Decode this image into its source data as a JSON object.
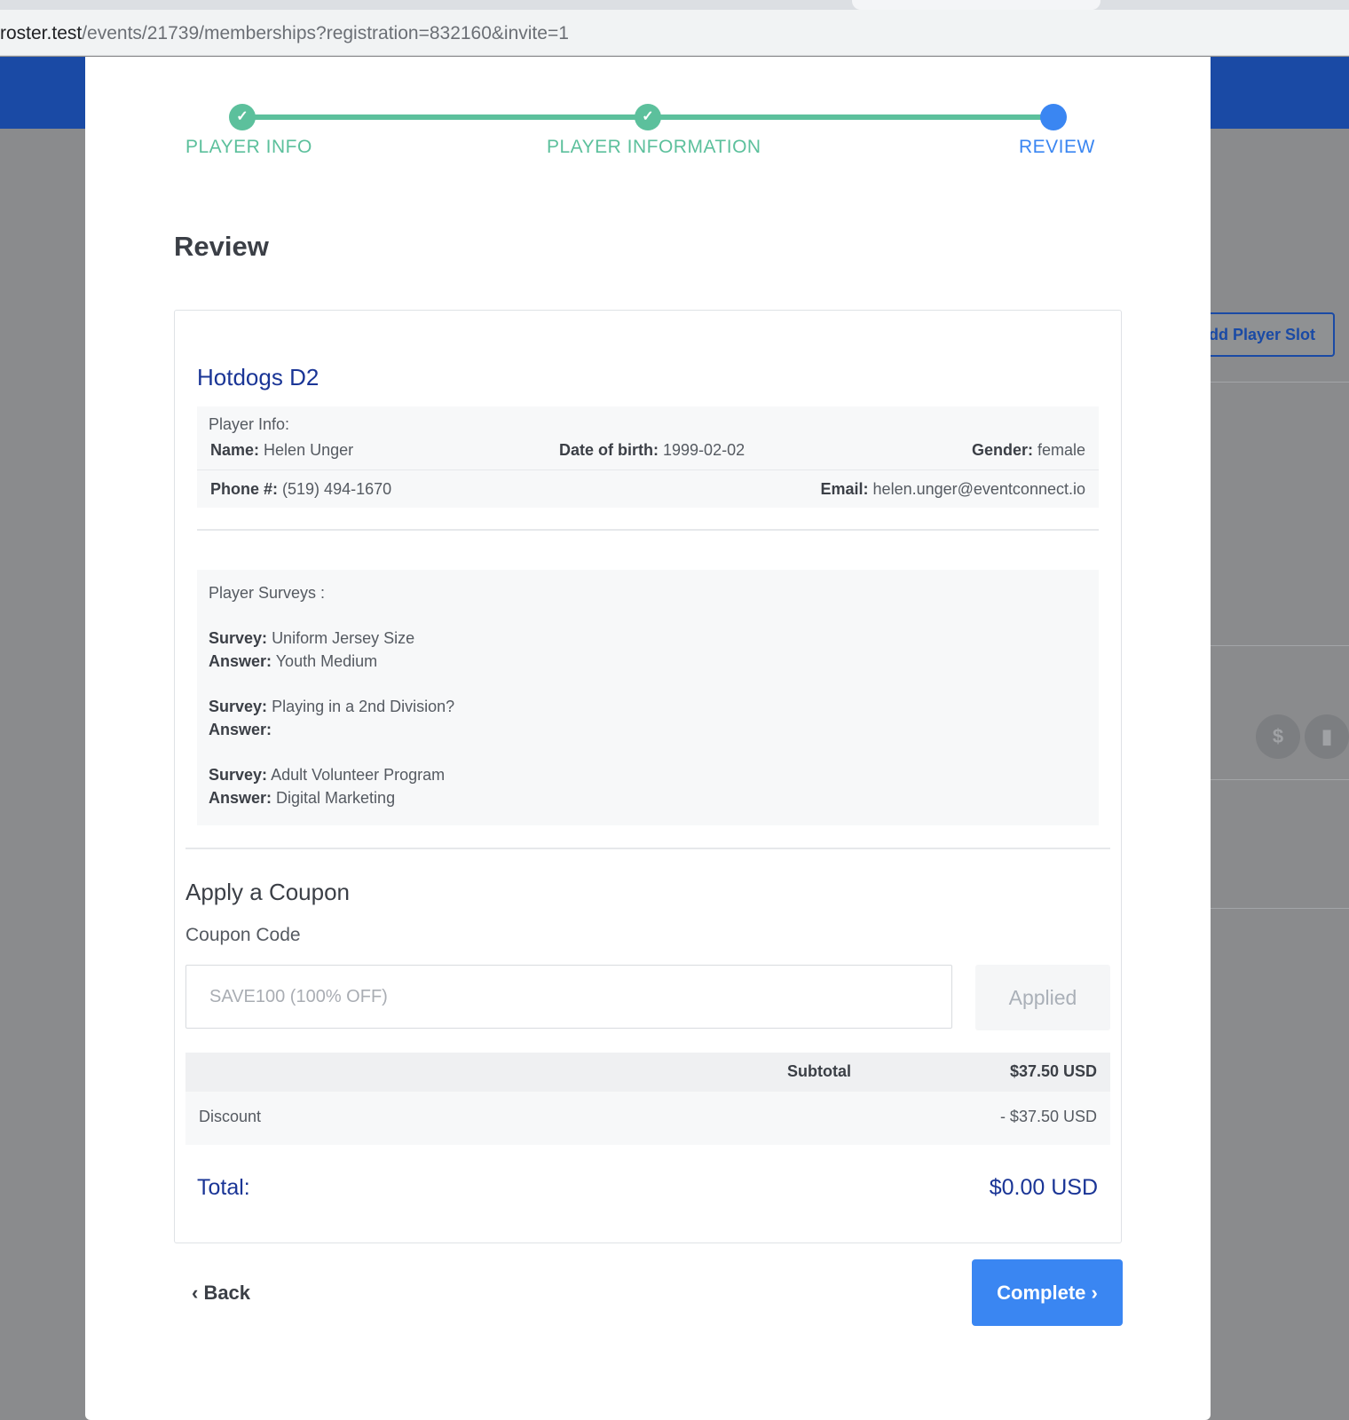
{
  "browser": {
    "url_host": "roster.test",
    "url_path": "/events/21739/memberships?registration=832160&invite=1"
  },
  "background": {
    "add_slot_label": "dd Player Slot",
    "icon_dollar": "$",
    "icon_doc": "▮"
  },
  "stepper": {
    "steps": [
      {
        "label": "PLAYER INFO",
        "state": "done",
        "icon": "check-icon"
      },
      {
        "label": "PLAYER INFORMATION",
        "state": "done",
        "icon": "check-icon"
      },
      {
        "label": "REVIEW",
        "state": "active"
      }
    ],
    "check_glyph": "✓"
  },
  "title": "Review",
  "card": {
    "team_name": "Hotdogs D2",
    "player_info_header": "Player Info:",
    "fields": {
      "name_label": "Name:",
      "name": "Helen Unger",
      "dob_label": "Date of birth:",
      "dob": "1999-02-02",
      "gender_label": "Gender:",
      "gender": "female",
      "phone_label": "Phone #:",
      "phone": "(519) 494-1670",
      "email_label": "Email:",
      "email": "helen.unger@eventconnect.io"
    },
    "surveys_header": "Player Surveys :",
    "survey_label": "Survey:",
    "answer_label": "Answer:",
    "surveys": [
      {
        "survey": "Uniform Jersey Size",
        "answer": "Youth Medium"
      },
      {
        "survey": "Playing in a 2nd Division?",
        "answer": ""
      },
      {
        "survey": "Adult Volunteer Program",
        "answer": "Digital Marketing"
      }
    ],
    "coupon": {
      "title": "Apply a Coupon",
      "label": "Coupon Code",
      "value": "SAVE100 (100% OFF)",
      "button": "Applied"
    },
    "totals": {
      "subtotal_label": "Subtotal",
      "subtotal": "$37.50 USD",
      "discount_label": "Discount",
      "discount": "- $37.50 USD",
      "total_label": "Total:",
      "total": "$0.00 USD"
    }
  },
  "actions": {
    "back_label": "‹ Back",
    "complete_label": "Complete ›"
  },
  "colors": {
    "accent": "#3a86f2",
    "step_done": "#5cc09c",
    "brand_dark": "#1a3596",
    "header_blue": "#1a4aa5"
  }
}
